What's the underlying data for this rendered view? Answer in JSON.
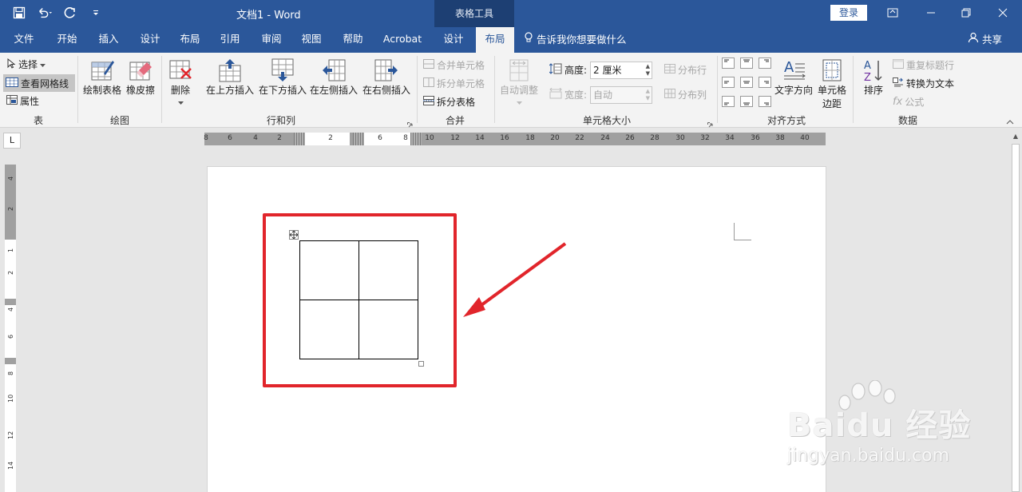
{
  "titlebar": {
    "doc_title": "文档1  -  Word",
    "context_title": "表格工具",
    "login_label": "登录"
  },
  "tabs": [
    {
      "label": "文件"
    },
    {
      "label": "开始"
    },
    {
      "label": "插入"
    },
    {
      "label": "设计"
    },
    {
      "label": "布局"
    },
    {
      "label": "引用"
    },
    {
      "label": "审阅"
    },
    {
      "label": "视图"
    },
    {
      "label": "帮助"
    },
    {
      "label": "Acrobat"
    },
    {
      "label": "设计"
    },
    {
      "label": "布局",
      "active": true
    }
  ],
  "tell_me": "告诉我你想要做什么",
  "share": "共享",
  "ribbon": {
    "table_group": {
      "label": "表",
      "select": "选择",
      "view_gridlines": "查看网格线",
      "properties": "属性"
    },
    "draw_group": {
      "label": "绘图",
      "draw_table": "绘制表格",
      "eraser": "橡皮擦"
    },
    "rows_cols_group": {
      "label": "行和列",
      "delete": "删除",
      "insert_above": "在上方插入",
      "insert_below": "在下方插入",
      "insert_left": "在左侧插入",
      "insert_right": "在右侧插入"
    },
    "merge_group": {
      "label": "合并",
      "merge_cells": "合并单元格",
      "split_cells": "拆分单元格",
      "split_table": "拆分表格"
    },
    "cell_size_group": {
      "label": "单元格大小",
      "autofit": "自动调整",
      "height_label": "高度:",
      "height_value": "2 厘米",
      "width_label": "宽度:",
      "width_value": "自动",
      "distribute_rows": "分布行",
      "distribute_cols": "分布列"
    },
    "align_group": {
      "label": "对齐方式",
      "text_direction": "文字方向",
      "cell_margins_1": "单元格",
      "cell_margins_2": "边距"
    },
    "data_group": {
      "label": "数据",
      "sort": "排序",
      "repeat_header": "重复标题行",
      "convert_text": "转换为文本",
      "formula": "公式"
    }
  },
  "ruler": {
    "corner": "L",
    "left_ticks": [
      "8",
      "6",
      "4",
      "2"
    ],
    "cell1_tick": "2",
    "cell2_ticks": [
      "6",
      "8"
    ],
    "right_ticks": [
      "10",
      "12",
      "14",
      "16",
      "18",
      "20",
      "22",
      "24",
      "26",
      "28",
      "30",
      "32",
      "34",
      "36",
      "38",
      "40"
    ],
    "v_ticks": [
      "4",
      "2",
      "1",
      "2",
      "4",
      "6",
      "8",
      "10",
      "12",
      "14"
    ]
  },
  "document": {
    "table": {
      "rows": 2,
      "cols": 2
    }
  },
  "watermark": {
    "brand": "Bai",
    "brand2": "du",
    "brand3": "经验",
    "url": "jingyan.baidu.com"
  },
  "colors": {
    "title_bar": "#2b579a",
    "context_tab": "#1d3f73",
    "highlight": "#e1252b"
  }
}
